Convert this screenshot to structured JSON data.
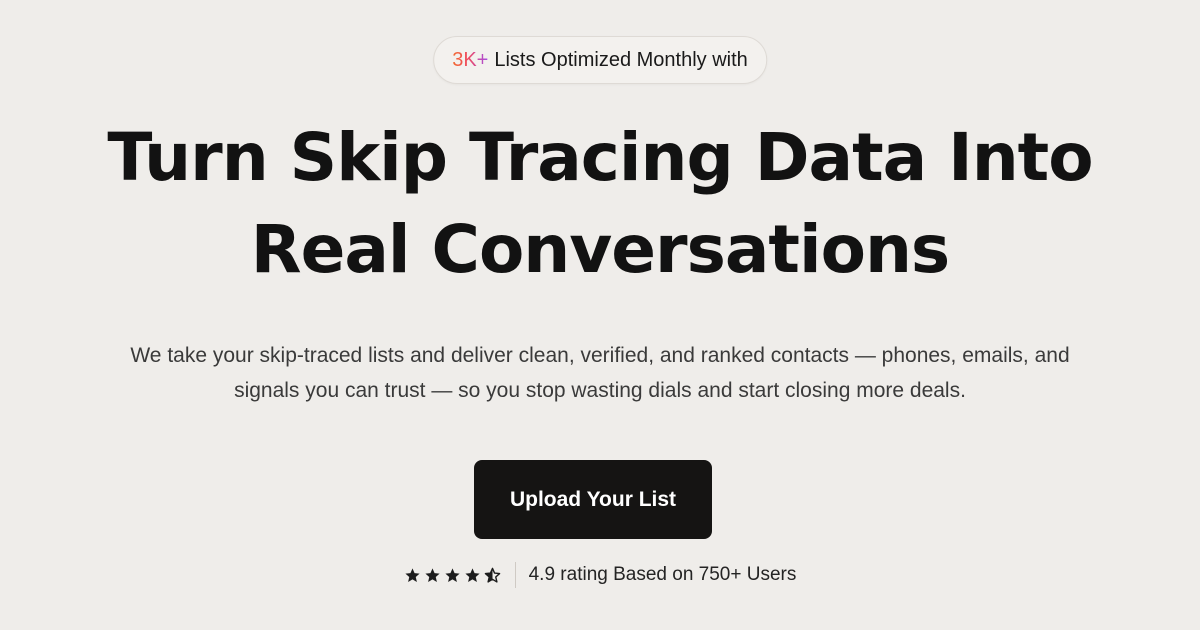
{
  "badge": {
    "highlight": "3K+",
    "text": "Lists Optimized Monthly with"
  },
  "headline": {
    "line1": "Turn Skip Tracing Data Into",
    "line2": "Real Conversations"
  },
  "subtext": {
    "line1": "We take your skip-traced lists and deliver clean, verified, and ranked contacts — phones, emails, and",
    "line2": "signals you can trust — so you stop wasting dials and start closing more deals."
  },
  "cta": {
    "label": "Upload Your List"
  },
  "rating": {
    "value": 4.5,
    "max": 5,
    "icons": [
      "star-icon",
      "star-icon",
      "star-icon",
      "star-icon",
      "star-half-icon"
    ],
    "text": "4.9 rating Based on 750+ Users"
  },
  "colors": {
    "background": "#efedea",
    "text": "#141414",
    "button": "#151413",
    "button_text": "#ffffff",
    "badge_gradient_start": "#f26b2e",
    "badge_gradient_mid": "#ef4a62",
    "badge_gradient_end": "#a34de6"
  }
}
